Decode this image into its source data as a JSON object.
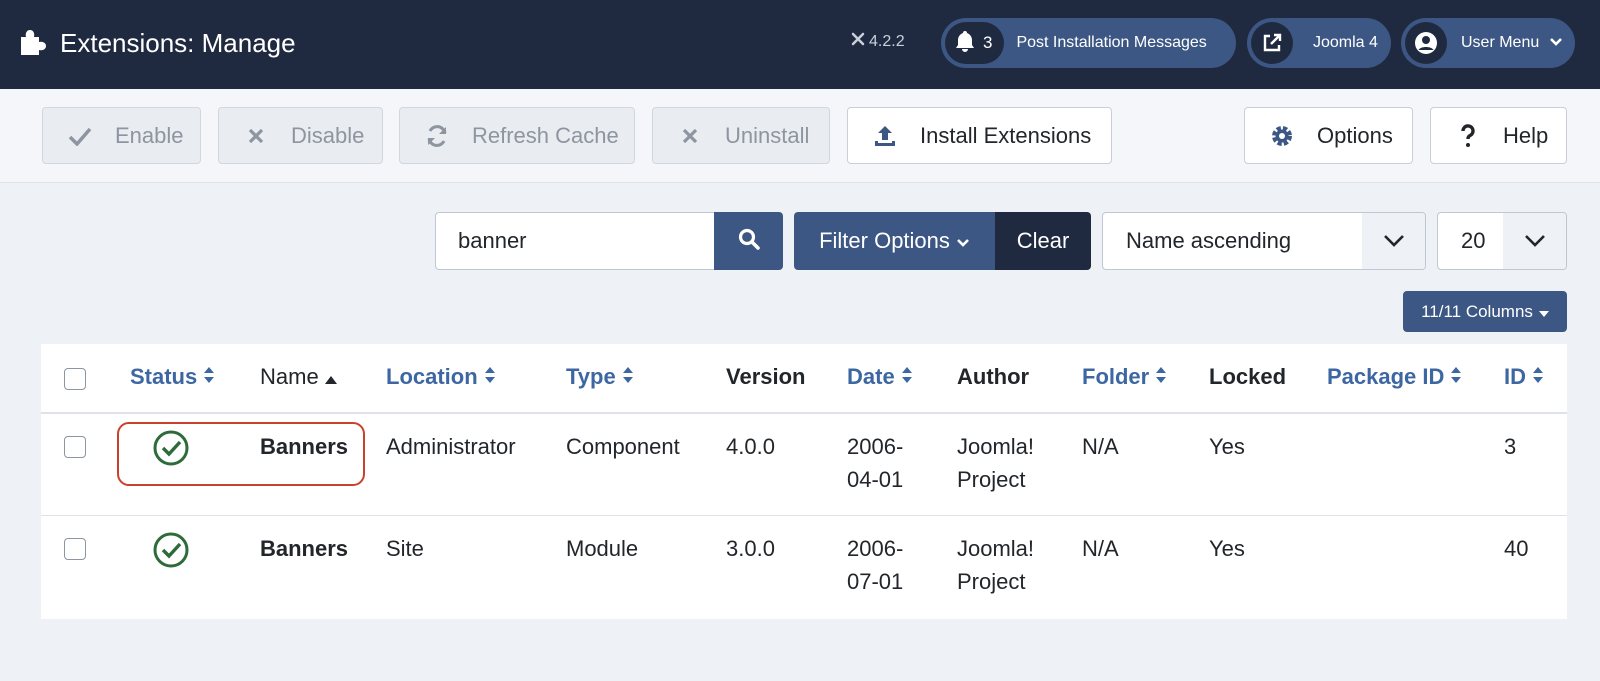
{
  "header": {
    "title": "Extensions: Manage",
    "version": "4.2.2",
    "messages_count": "3",
    "messages_label": "Post Installation Messages",
    "site_label": "Joomla 4",
    "user_label": "User Menu"
  },
  "toolbar": {
    "enable": "Enable",
    "disable": "Disable",
    "refresh": "Refresh Cache",
    "uninstall": "Uninstall",
    "install": "Install Extensions",
    "options": "Options",
    "help": "Help"
  },
  "filters": {
    "search_value": "banner",
    "filter_options": "Filter Options",
    "clear": "Clear",
    "ordering": "Name ascending",
    "limit": "20",
    "columns": "11/11 Columns"
  },
  "table": {
    "headers": {
      "status": "Status",
      "name": "Name",
      "location": "Location",
      "type": "Type",
      "version": "Version",
      "date": "Date",
      "author": "Author",
      "folder": "Folder",
      "locked": "Locked",
      "package_id": "Package ID",
      "id": "ID"
    },
    "rows": [
      {
        "name": "Banners",
        "location": "Administrator",
        "type": "Component",
        "version": "4.0.0",
        "date_line1": "2006-",
        "date_line2": "04-01",
        "author_line1": "Joomla!",
        "author_line2": "Project",
        "folder": "N/A",
        "locked": "Yes",
        "package_id": "",
        "id": "3"
      },
      {
        "name": "Banners",
        "location": "Site",
        "type": "Module",
        "version": "3.0.0",
        "date_line1": "2006-",
        "date_line2": "07-01",
        "author_line1": "Joomla!",
        "author_line2": "Project",
        "folder": "N/A",
        "locked": "Yes",
        "package_id": "",
        "id": "40"
      }
    ]
  },
  "colors": {
    "header_bg": "#1f2a40",
    "accent": "#3d5784",
    "link": "#3d67a3",
    "success": "#2e6b3a",
    "highlight": "#c9412a"
  },
  "icons": [
    "puzzle-icon",
    "joomla-icon",
    "bell-icon",
    "external-link-icon",
    "user-icon",
    "check-icon",
    "times-icon",
    "refresh-icon",
    "upload-icon",
    "gear-icon",
    "question-icon",
    "search-icon",
    "chevron-down-icon",
    "sort-icon",
    "sort-asc-icon",
    "check-circle-icon"
  ]
}
